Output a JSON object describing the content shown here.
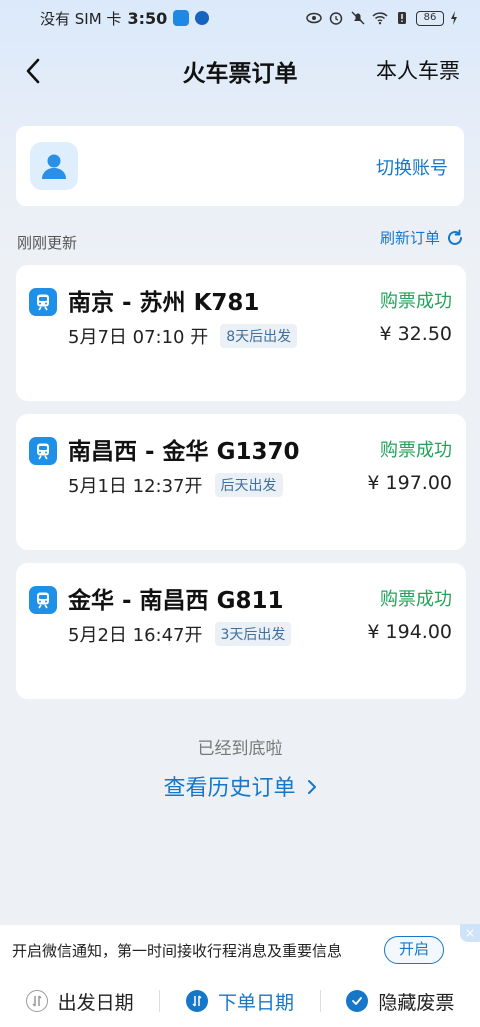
{
  "status_bar": {
    "carrier": "没有 SIM 卡",
    "time": "3:50",
    "battery": "86"
  },
  "header": {
    "title": "火车票订单",
    "right_link": "本人车票"
  },
  "account": {
    "switch_label": "切换账号"
  },
  "section": {
    "updated_label": "刚刚更新",
    "refresh_label": "刷新订单"
  },
  "orders": [
    {
      "route": "南京 - 苏州 K781",
      "status": "购票成功",
      "depart": "5月7日 07:10 开",
      "countdown": "8天后出发",
      "price": "¥ 32.50"
    },
    {
      "route": "南昌西 - 金华 G1370",
      "status": "购票成功",
      "depart": "5月1日 12:37开",
      "countdown": "后天出发",
      "price": "¥ 197.00"
    },
    {
      "route": "金华 - 南昌西 G811",
      "status": "购票成功",
      "depart": "5月2日 16:47开",
      "countdown": "3天后出发",
      "price": "¥ 194.00"
    }
  ],
  "footer": {
    "end_text": "已经到底啦",
    "history_link": "查看历史订单"
  },
  "notice": {
    "text": "开启微信通知，第一时间接收行程消息及重要信息",
    "button": "开启",
    "close": "×"
  },
  "tabs": [
    {
      "label": "出发日期",
      "active": false
    },
    {
      "label": "下单日期",
      "active": true
    },
    {
      "label": "隐藏废票",
      "active": false
    }
  ],
  "colors": {
    "accent": "#1677c9",
    "success": "#21a45a",
    "background": "#edf1f6"
  }
}
